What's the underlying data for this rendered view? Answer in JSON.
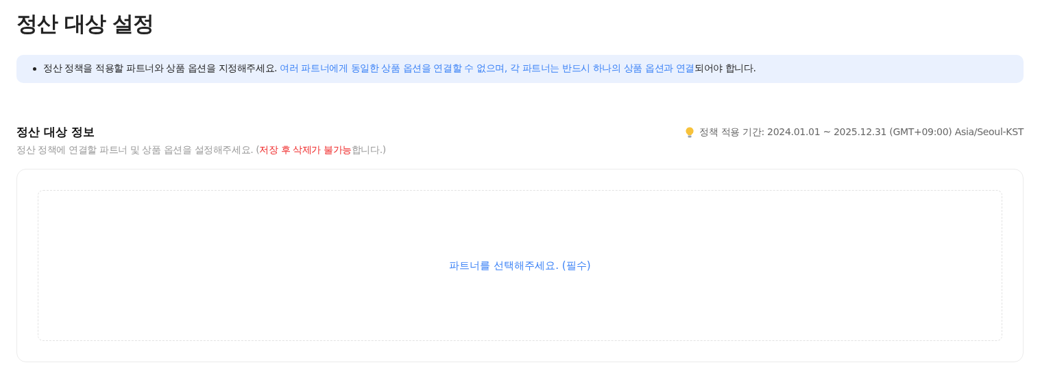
{
  "page_title": "정산 대상 설정",
  "notice": {
    "segments": [
      {
        "kind": "plain",
        "text": "정산 정책을 적용할 파트너와 상품 옵션을 지정해주세요. "
      },
      {
        "kind": "highlight",
        "text": "여러 파트너에게 동일한 상품 옵션을 연결할 수 없으며, 각 파트너는 반드시 하나의 상품 옵션과 연결"
      },
      {
        "kind": "plain",
        "text": "되어야 합니다."
      }
    ]
  },
  "section": {
    "title": "정산 대상 정보",
    "period": "정책 적용 기간: 2024.01.01 ~ 2025.12.31 (GMT+09:00) Asia/Seoul-KST",
    "description": [
      {
        "kind": "plain",
        "text": "정산 정책에 연결할 파트너 및 상품 옵션을 설정해주세요. ("
      },
      {
        "kind": "warning",
        "text": "저장 후 삭제가 불가능"
      },
      {
        "kind": "plain",
        "text": "합니다.)"
      }
    ],
    "select_partner": "파트너를 선택해주세요. (필수)"
  }
}
